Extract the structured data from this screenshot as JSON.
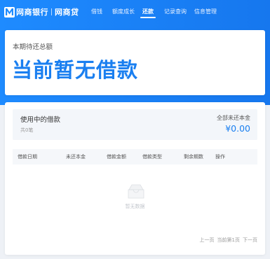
{
  "brand": {
    "bank_name": "网商银行",
    "product_name": "网商贷"
  },
  "nav": {
    "items": [
      {
        "label": "借钱",
        "active": false
      },
      {
        "label": "额度成长",
        "active": false
      },
      {
        "label": "还款",
        "active": true
      },
      {
        "label": "记录查询",
        "active": false
      },
      {
        "label": "信息管理",
        "active": false
      }
    ]
  },
  "summary": {
    "label": "本期待还总额",
    "value": "当前暂无借款"
  },
  "loans": {
    "title": "使用中的借款",
    "count": "共0笔",
    "principal_label": "全部未还本金",
    "principal_value": "¥0.00",
    "columns": [
      "借款日期",
      "未还本金",
      "借款金额",
      "借款类型",
      "剩余期数",
      "操作"
    ],
    "empty_text": "暂无数据"
  },
  "pager": {
    "prev": "上一页",
    "current": "当前第1页",
    "next": "下一页"
  },
  "colors": {
    "primary": "#1a7ff0",
    "header_bg": "#1e8bff"
  }
}
